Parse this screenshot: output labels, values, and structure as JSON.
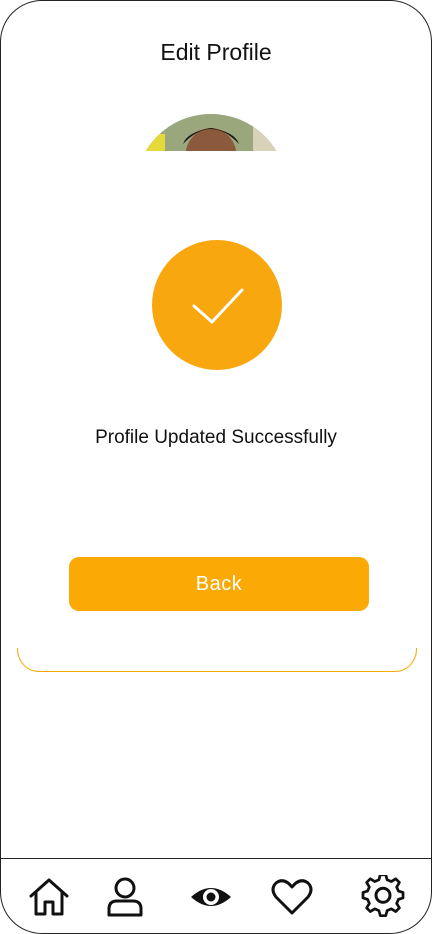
{
  "header": {
    "title": "Edit Profile"
  },
  "avatar": {
    "icon": "avatar-photo"
  },
  "success": {
    "icon": "checkmark-icon",
    "message": "Profile Updated Successfully",
    "accent_color": "#f9a70f"
  },
  "actions": {
    "back_label": "Back"
  },
  "bottom_nav": {
    "items": [
      {
        "icon": "home-icon"
      },
      {
        "icon": "user-icon"
      },
      {
        "icon": "eye-icon"
      },
      {
        "icon": "heart-icon"
      },
      {
        "icon": "gear-icon"
      }
    ]
  },
  "colors": {
    "primary": "#fba904",
    "text": "#111111",
    "background": "#ffffff"
  }
}
